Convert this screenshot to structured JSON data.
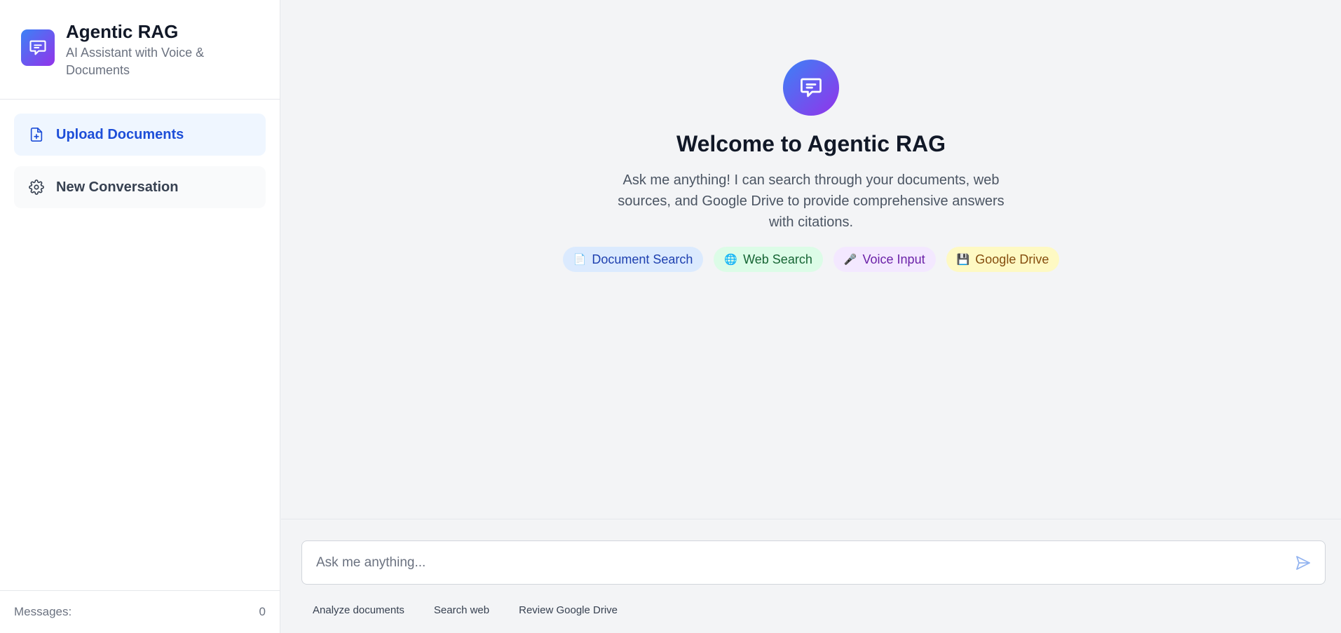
{
  "app": {
    "title": "Agentic RAG",
    "subtitle": "AI Assistant with Voice & Documents",
    "logo_icon": "chat-bubble-icon",
    "accent_gradient": [
      "#3b82f6",
      "#9333ea"
    ]
  },
  "sidebar": {
    "items": [
      {
        "label": "Upload Documents",
        "icon": "file-plus-icon",
        "active": true
      },
      {
        "label": "New Conversation",
        "icon": "gear-icon",
        "active": false
      }
    ],
    "footer": {
      "label": "Messages:",
      "count": "0"
    }
  },
  "main": {
    "welcome_title": "Welcome to Agentic RAG",
    "welcome_description": "Ask me anything! I can search through your documents, web sources, and Google Drive to provide comprehensive answers with citations.",
    "features": [
      {
        "label": "Document Search",
        "icon": "📄",
        "color": "#1e40af"
      },
      {
        "label": "Web Search",
        "icon": "🌐",
        "color": "#166534"
      },
      {
        "label": "Voice Input",
        "icon": "🎤",
        "color": "#6b21a8"
      },
      {
        "label": "Google Drive",
        "icon": "💾",
        "color": "#854d0e"
      }
    ]
  },
  "composer": {
    "placeholder": "Ask me anything...",
    "value": "",
    "send_icon": "send-icon",
    "suggestions": [
      "Analyze documents",
      "Search web",
      "Review Google Drive"
    ]
  }
}
